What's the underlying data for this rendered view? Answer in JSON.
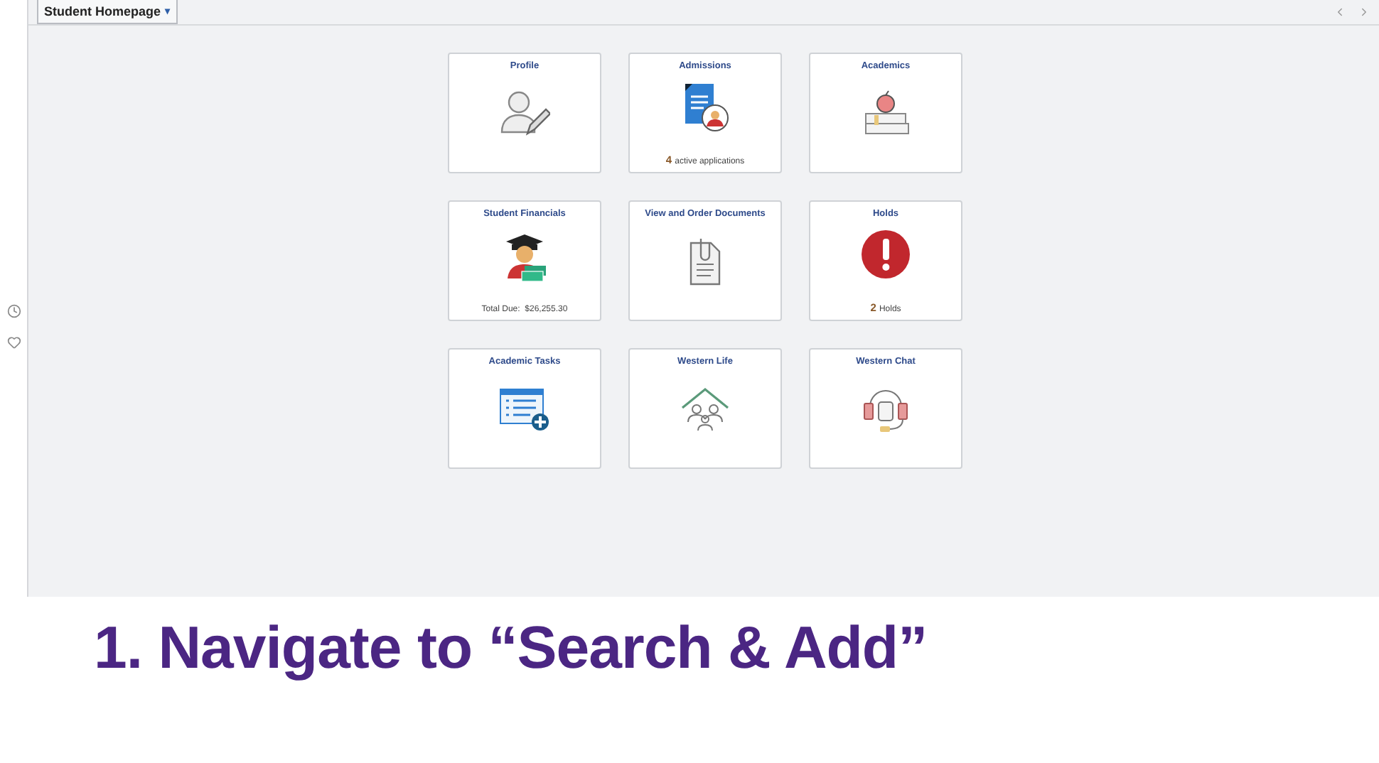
{
  "header": {
    "title": "Student Homepage",
    "caret": "▾"
  },
  "tiles": [
    {
      "title": "Profile"
    },
    {
      "title": "Admissions",
      "footer": {
        "count": "4",
        "text": "active applications"
      }
    },
    {
      "title": "Academics"
    },
    {
      "title": "Student Financials",
      "footer": {
        "text": "Total Due:  $26,255.30"
      }
    },
    {
      "title": "View and Order Documents"
    },
    {
      "title": "Holds",
      "footer": {
        "count": "2",
        "text": "Holds"
      }
    },
    {
      "title": "Academic Tasks"
    },
    {
      "title": "Western Life"
    },
    {
      "title": "Western Chat"
    }
  ],
  "caption": "1. Navigate to “Search & Add”"
}
